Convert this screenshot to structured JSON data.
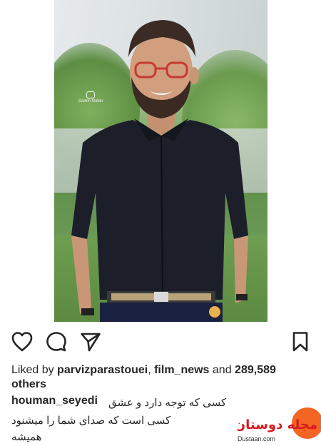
{
  "post": {
    "likes_prefix": "Liked by ",
    "liker1": "parvizparastouei",
    "sep": ", ",
    "liker2": "film_news",
    "and": " and ",
    "count": "289,589",
    "others": "others",
    "caption_user": "houman_seyedi",
    "caption_line1": "کسی که توجه دارد و عشق",
    "caption_line2": "کسی است که صدای شما را میشنود",
    "caption_line3": "همیشه"
  },
  "photo": {
    "watermark_text": "Samin Nobin"
  },
  "watermark": {
    "logo_text": "مجله دوستان",
    "url": "Dustaan.com"
  },
  "icons": {
    "like": "heart-icon",
    "comment": "comment-icon",
    "share": "send-icon",
    "save": "bookmark-icon"
  },
  "colors": {
    "text": "#262626",
    "watermark_orange": "#f26522",
    "watermark_red": "#d71920"
  }
}
